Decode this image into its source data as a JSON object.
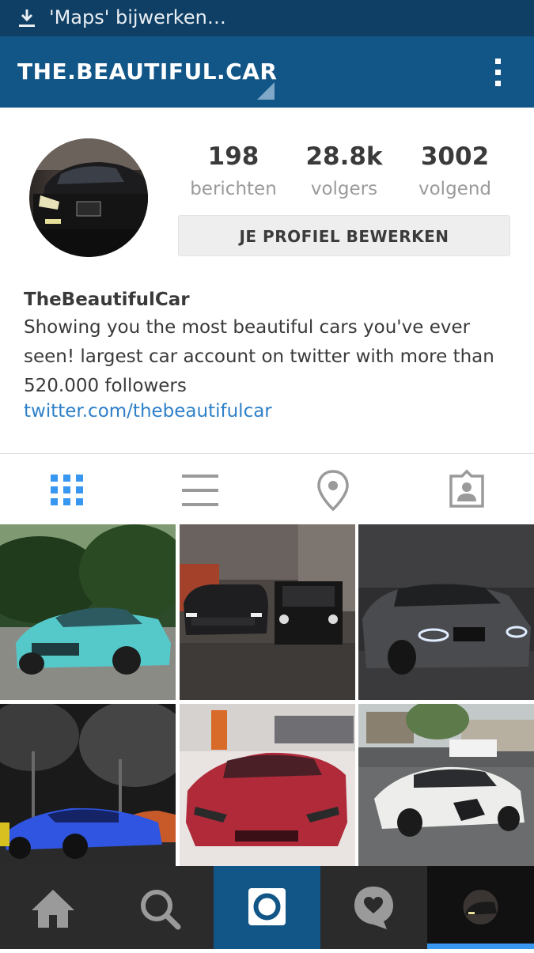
{
  "status_bar": {
    "notification_text": "'Maps' bijwerken…",
    "icon": "download-icon"
  },
  "app_bar": {
    "title": "THE.BEAUTIFUL.CAR",
    "menu_icon": "more-vert-icon"
  },
  "profile": {
    "stats": [
      {
        "value": "198",
        "label": "berichten"
      },
      {
        "value": "28.8k",
        "label": "volgers"
      },
      {
        "value": "3002",
        "label": "volgend"
      }
    ],
    "edit_button": "JE PROFIEL BEWERKEN",
    "name": "TheBeautifulCar",
    "bio": "Showing you the most beautiful cars you've ever seen! largest car account on twitter with more than 520.000 followers",
    "link": "twitter.com/thebeautifulcar"
  },
  "tabs": [
    {
      "icon": "grid-icon",
      "active": true
    },
    {
      "icon": "list-icon",
      "active": false
    },
    {
      "icon": "location-pin-icon",
      "active": false
    },
    {
      "icon": "tagged-photos-icon",
      "active": false
    }
  ],
  "posts": [
    {
      "subject": "turquoise Maserati GranTurismo"
    },
    {
      "subject": "Range Rover and Mercedes G-Class at night"
    },
    {
      "subject": "matte grey BMW M4"
    },
    {
      "subject": "blue Koenigsegg"
    },
    {
      "subject": "matte red Lamborghini Aventador roadster"
    },
    {
      "subject": "white Lexus RC F widebody"
    }
  ],
  "bottom_nav": [
    {
      "icon": "home-icon",
      "active": false
    },
    {
      "icon": "search-icon",
      "active": false
    },
    {
      "icon": "camera-icon",
      "active": true
    },
    {
      "icon": "activity-heart-icon",
      "active": false
    },
    {
      "icon": "profile-avatar-icon",
      "active": false
    }
  ],
  "colors": {
    "status_bar": "#0f3f64",
    "app_bar": "#125688",
    "link": "#2f80c8",
    "active_tab": "#3897f0",
    "bottom_nav": "#2b2b2b",
    "camera_button": "#125688"
  }
}
